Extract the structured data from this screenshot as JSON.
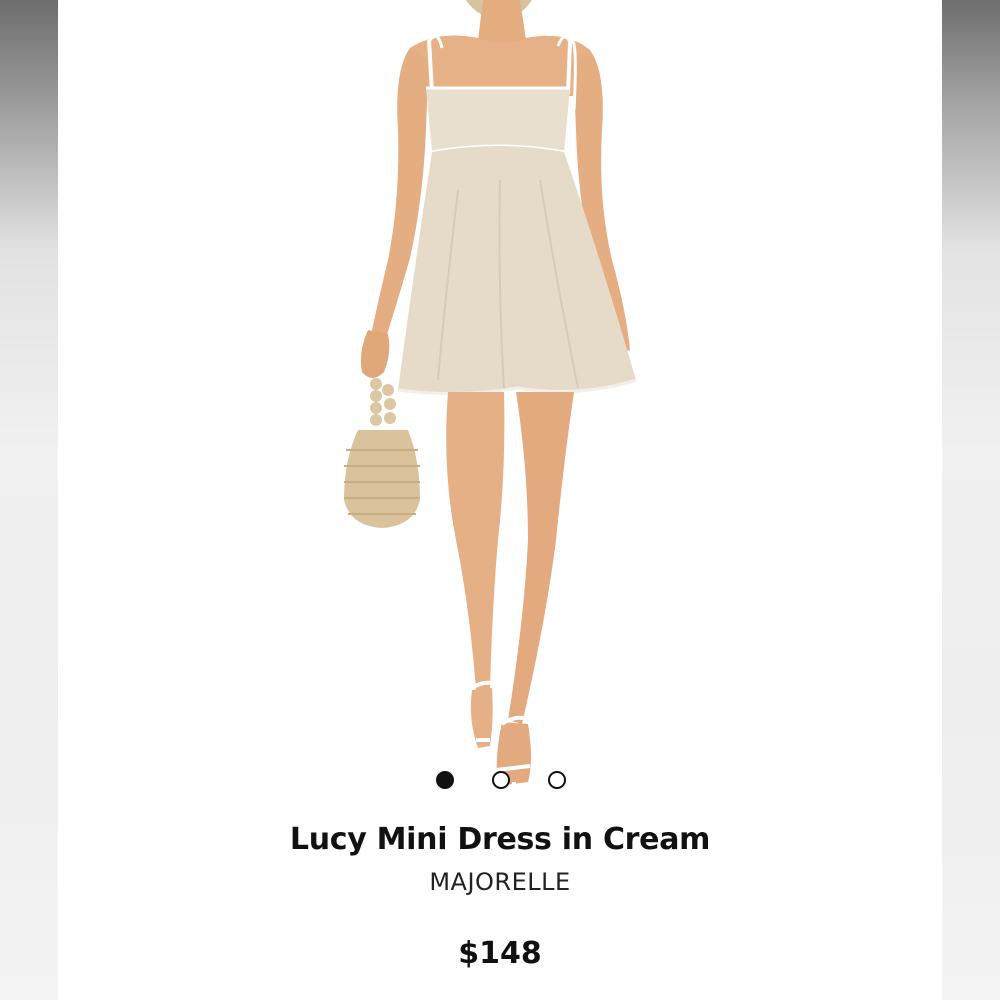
{
  "product": {
    "title": "Lucy Mini Dress in Cream",
    "brand": "MAJORELLE",
    "price": "$148",
    "image": {
      "subject": "model-wearing-dress",
      "dress_color": "#e9dfcf",
      "piping_color": "#ffffff",
      "skin_color": "#e7b387",
      "bag_color": "#d9c29c"
    }
  },
  "carousel": {
    "total": 3,
    "active_index": 0,
    "dot_color": "#111111"
  },
  "colors": {
    "background": "#ffffff",
    "frame": "#eeeeee",
    "scrollbar": "#7f7f7f"
  }
}
